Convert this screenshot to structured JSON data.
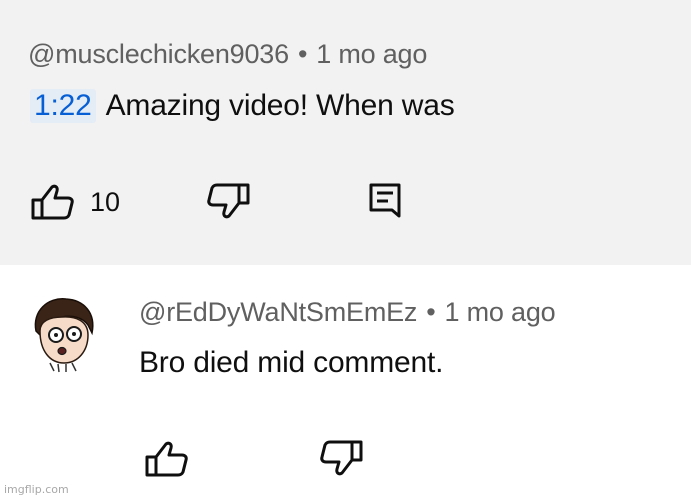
{
  "comment": {
    "username": "@musclechicken9036",
    "age": "1 mo ago",
    "separator": "•",
    "timestamp": "1:22",
    "text": "Amazing video! When was",
    "like_count": "10",
    "icons": [
      "thumbs-up-icon",
      "thumbs-down-icon",
      "reply-icon"
    ]
  },
  "reply": {
    "username": "@rEdDyWaNtSmEmEz",
    "age": "1 mo ago",
    "separator": "•",
    "text": "Bro died mid comment.",
    "icons": [
      "avatar",
      "thumbs-up-icon",
      "thumbs-down-icon"
    ]
  },
  "watermark": "imgflip.com",
  "colors": {
    "top_background": "#f2f2f2",
    "timestamp_link": "#065fd4",
    "meta_text": "#606060"
  }
}
